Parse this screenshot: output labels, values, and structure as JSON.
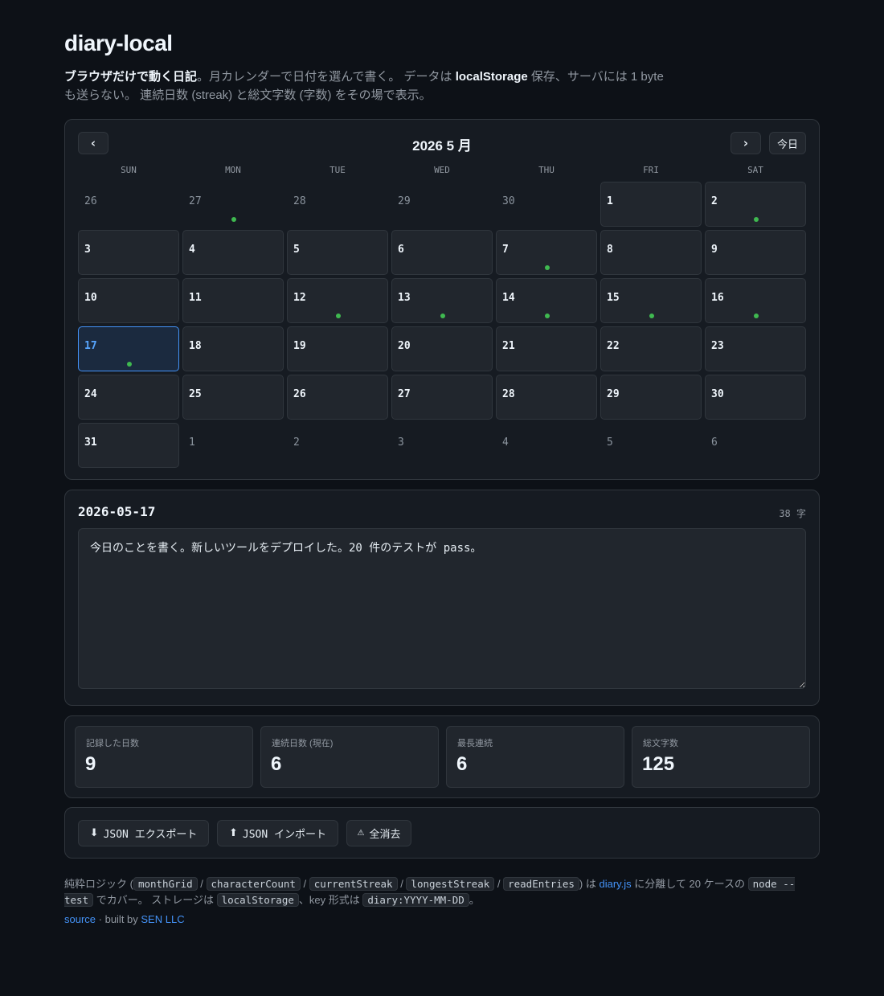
{
  "app": {
    "title": "diary-local",
    "intro": {
      "bold1": "ブラウザだけで動く日記",
      "text1": "。月カレンダーで日付を選んで書く。 データは ",
      "bold2": "localStorage",
      "text2": " 保存、サーバには 1 byte も送らない。 連続日数 (streak) と総文字数 (字数) をその場で表示。"
    }
  },
  "calendar": {
    "title": "2026 5 月",
    "prev_label": "‹",
    "next_label": "›",
    "today_label": "今日",
    "weekdays": [
      "SUN",
      "MON",
      "TUE",
      "WED",
      "THU",
      "FRI",
      "SAT"
    ],
    "days": [
      {
        "n": "26",
        "in": false,
        "entry": false
      },
      {
        "n": "27",
        "in": false,
        "entry": true
      },
      {
        "n": "28",
        "in": false,
        "entry": false
      },
      {
        "n": "29",
        "in": false,
        "entry": false
      },
      {
        "n": "30",
        "in": false,
        "entry": false
      },
      {
        "n": "1",
        "in": true,
        "entry": false
      },
      {
        "n": "2",
        "in": true,
        "entry": true
      },
      {
        "n": "3",
        "in": true,
        "entry": false
      },
      {
        "n": "4",
        "in": true,
        "entry": false
      },
      {
        "n": "5",
        "in": true,
        "entry": false
      },
      {
        "n": "6",
        "in": true,
        "entry": false
      },
      {
        "n": "7",
        "in": true,
        "entry": true
      },
      {
        "n": "8",
        "in": true,
        "entry": false
      },
      {
        "n": "9",
        "in": true,
        "entry": false
      },
      {
        "n": "10",
        "in": true,
        "entry": false
      },
      {
        "n": "11",
        "in": true,
        "entry": false
      },
      {
        "n": "12",
        "in": true,
        "entry": true
      },
      {
        "n": "13",
        "in": true,
        "entry": true
      },
      {
        "n": "14",
        "in": true,
        "entry": true
      },
      {
        "n": "15",
        "in": true,
        "entry": true
      },
      {
        "n": "16",
        "in": true,
        "entry": true
      },
      {
        "n": "17",
        "in": true,
        "entry": true,
        "today": true
      },
      {
        "n": "18",
        "in": true,
        "entry": false
      },
      {
        "n": "19",
        "in": true,
        "entry": false
      },
      {
        "n": "20",
        "in": true,
        "entry": false
      },
      {
        "n": "21",
        "in": true,
        "entry": false
      },
      {
        "n": "22",
        "in": true,
        "entry": false
      },
      {
        "n": "23",
        "in": true,
        "entry": false
      },
      {
        "n": "24",
        "in": true,
        "entry": false
      },
      {
        "n": "25",
        "in": true,
        "entry": false
      },
      {
        "n": "26",
        "in": true,
        "entry": false
      },
      {
        "n": "27",
        "in": true,
        "entry": false
      },
      {
        "n": "28",
        "in": true,
        "entry": false
      },
      {
        "n": "29",
        "in": true,
        "entry": false
      },
      {
        "n": "30",
        "in": true,
        "entry": false
      },
      {
        "n": "31",
        "in": true,
        "entry": false
      },
      {
        "n": "1",
        "in": false,
        "entry": false
      },
      {
        "n": "2",
        "in": false,
        "entry": false
      },
      {
        "n": "3",
        "in": false,
        "entry": false
      },
      {
        "n": "4",
        "in": false,
        "entry": false
      },
      {
        "n": "5",
        "in": false,
        "entry": false
      },
      {
        "n": "6",
        "in": false,
        "entry": false
      }
    ]
  },
  "editor": {
    "date": "2026-05-17",
    "char_count": "38 字",
    "text": "今日のことを書く。新しいツールをデプロイした。20 件のテストが pass。"
  },
  "stats": [
    {
      "label": "記録した日数",
      "value": "9"
    },
    {
      "label": "連続日数 (現在)",
      "value": "6"
    },
    {
      "label": "最長連続",
      "value": "6"
    },
    {
      "label": "総文字数",
      "value": "125"
    }
  ],
  "actions": {
    "export_label": "JSON エクスポート",
    "import_label": "JSON インポート",
    "clear_label": "全消去",
    "export_icon": "⬇",
    "import_icon": "⬆",
    "clear_icon": "⚠"
  },
  "footer": {
    "t1": "純粋ロジック (",
    "c1": "monthGrid",
    "s1": " / ",
    "c2": "characterCount",
    "s2": " / ",
    "c3": "currentStreak",
    "s3": " / ",
    "c4": "longestStreak",
    "s4": " / ",
    "c5": "readEntries",
    "t2": ") は ",
    "link1": "diary.js",
    "t3": " に分離して 20 ケースの ",
    "c6": "node --test",
    "t4": " でカバー。 ストレージは ",
    "c7": "localStorage",
    "t5": "、key 形式は ",
    "c8": "diary:YYYY-MM-DD",
    "t6": "。",
    "source_label": "source",
    "sep": " · built by ",
    "author_label": "SEN LLC"
  },
  "colors": {
    "background": "#0d1117",
    "panel": "#161b22",
    "accent": "#4493f8",
    "entry_dot": "#3fb950"
  }
}
